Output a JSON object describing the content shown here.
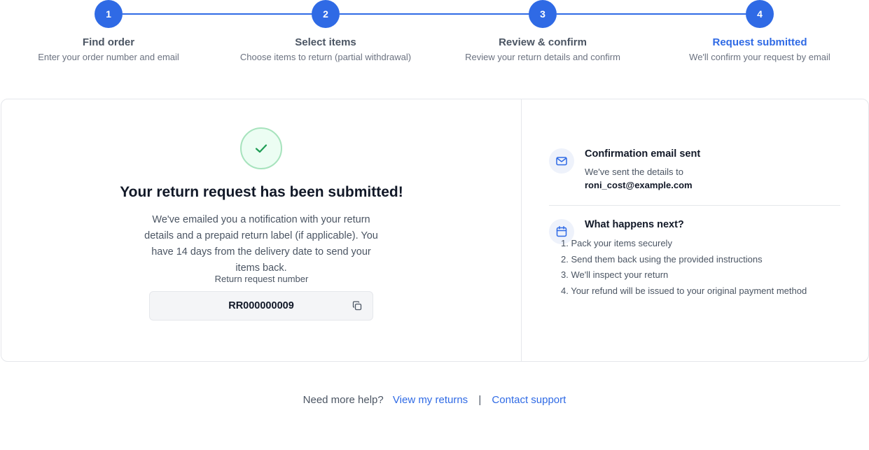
{
  "stepper": {
    "steps": [
      {
        "number": "1",
        "title": "Find order",
        "description": "Enter your order number and email"
      },
      {
        "number": "2",
        "title": "Select items",
        "description": "Choose items to return (partial withdrawal)"
      },
      {
        "number": "3",
        "title": "Review & confirm",
        "description": "Review your return details and confirm"
      },
      {
        "number": "4",
        "title": "Request submitted",
        "description": "We'll confirm your request by email"
      }
    ],
    "active_step": "4"
  },
  "success": {
    "title": "Your return request has been submitted!",
    "message": "We've emailed you a notification with your return details and a prepaid return label (if applicable). You have 14 days from the delivery date to send your items back.",
    "reference_label": "Return request number",
    "reference_number": "RR000000009"
  },
  "confirmation": {
    "title": "Confirmation email sent",
    "line": "We've sent the details to",
    "email": "roni_cost@example.com"
  },
  "next_steps": {
    "title": "What happens next?",
    "items": [
      "1. Pack your items securely",
      "2. Send them back using the provided instructions",
      "3. We'll inspect your return",
      "4. Your refund will be issued to your original payment method"
    ]
  },
  "footer": {
    "help_text": "Need more help?",
    "view_returns": "View my returns",
    "separator": "|",
    "contact_support": "Contact support"
  },
  "colors": {
    "accent": "#2f6ae5",
    "success": "#1f9d55",
    "muted_text": "#4b5563"
  },
  "icons": {
    "success": "check-icon",
    "copy": "copy-icon",
    "email": "mail-icon",
    "next": "calendar-icon"
  }
}
